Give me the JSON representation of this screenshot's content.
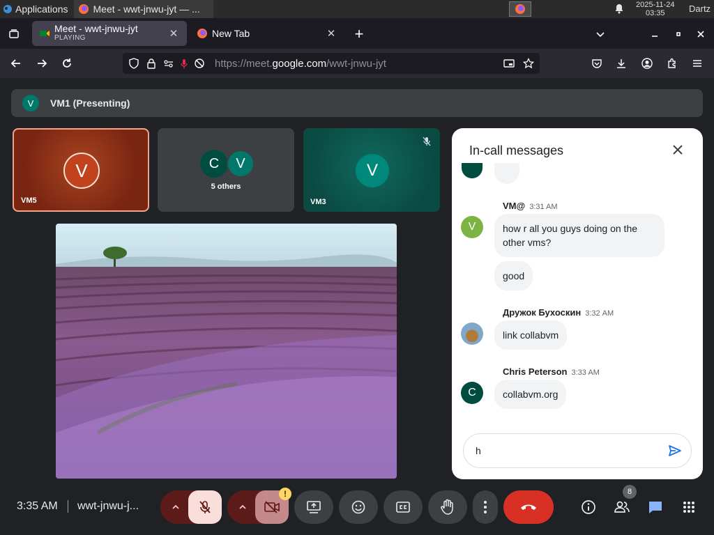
{
  "os": {
    "apps_label": "Applications",
    "task_title": "Meet - wwt-jnwu-jyt — ...",
    "clock_date": "2025-11-24",
    "clock_time": "03:35",
    "user": "Dartz"
  },
  "browser": {
    "tabs": [
      {
        "title": "Meet - wwt-jnwu-jyt",
        "subtitle": "PLAYING"
      },
      {
        "title": "New Tab"
      }
    ],
    "url_prefix": "https://meet.",
    "url_domain": "google.com",
    "url_path": "/wwt-jnwu-jyt"
  },
  "meet": {
    "presenting_initial": "V",
    "presenting_label": "VM1 (Presenting)",
    "tiles": [
      {
        "initial": "V",
        "label": "VM5"
      },
      {
        "initials": [
          "C",
          "V"
        ],
        "label": "5 others"
      },
      {
        "initial": "V",
        "label": "VM3"
      }
    ],
    "chat": {
      "title": "In-call messages",
      "messages": [
        {
          "sender": "VM@",
          "time": "3:31 AM",
          "avatar_initial": "V",
          "texts": [
            "how r all you guys doing on the other vms?",
            "good"
          ]
        },
        {
          "sender": "Дружок Бухоскин",
          "time": "3:32 AM",
          "texts": [
            "link collabvm"
          ]
        },
        {
          "sender": "Chris Peterson",
          "time": "3:33 AM",
          "avatar_initial": "C",
          "texts": [
            "collabvm.org"
          ]
        }
      ],
      "input_value": "h"
    },
    "bottom": {
      "time": "3:35 AM",
      "code": "wwt-jnwu-j...",
      "people_count": "8"
    }
  },
  "colors": {
    "vm5_tile": "#8a2a10",
    "vm3_tile": "#0f5b52",
    "end_call": "#d93025",
    "muted_bg": "#f9dedc",
    "chat_send": "#1a73e8"
  }
}
